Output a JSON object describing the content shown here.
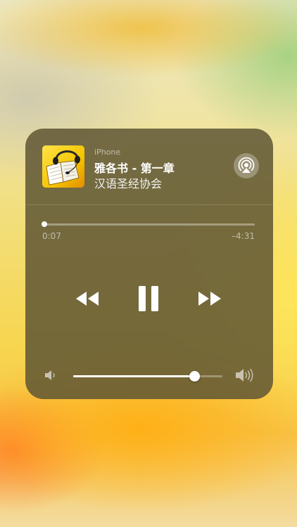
{
  "now_playing": {
    "device_label": "iPhone",
    "title": "雅各书 - 第一章",
    "artist": "汉语圣经协会",
    "artwork_icon": "book-headphones-artwork-icon",
    "airplay_icon": "airplay-icon"
  },
  "playback": {
    "elapsed": "0:07",
    "remaining": "–4:31",
    "progress_fraction": 0.01,
    "state": "playing",
    "rewind_icon": "rewind-icon",
    "pause_icon": "pause-icon",
    "forward_icon": "fast-forward-icon"
  },
  "volume": {
    "level_fraction": 0.81,
    "min_icon": "speaker-low-icon",
    "max_icon": "speaker-high-icon"
  },
  "colors": {
    "artwork_background": "#f5c400",
    "control_glyph": "#ffffff"
  }
}
